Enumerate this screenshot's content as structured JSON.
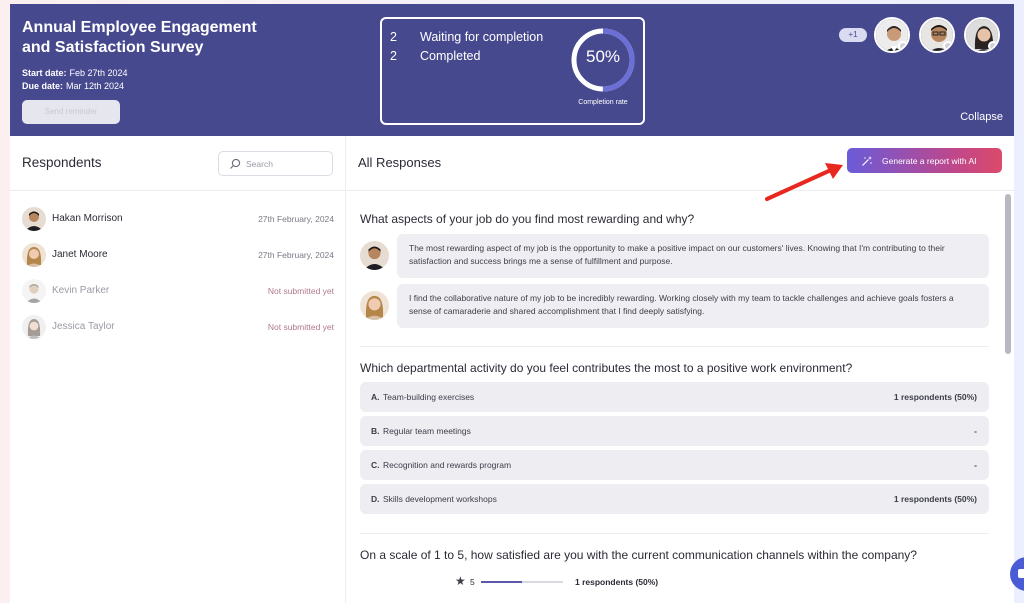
{
  "survey": {
    "title": "Annual Employee Engagement and Satisfaction Survey",
    "start_label": "Start date:",
    "start_value": "Feb 27th 2024",
    "due_label": "Due date:",
    "due_value": "Mar 12th 2024",
    "reminder_label": "Send reminder"
  },
  "stats": {
    "waiting_count": "2",
    "waiting_label": "Waiting for completion",
    "completed_count": "2",
    "completed_label": "Completed",
    "rate_text": "50%",
    "rate_fraction": 0.5,
    "rate_caption": "Completion rate"
  },
  "header": {
    "extra_badge": "+1",
    "collapse_label": "Collapse"
  },
  "respondents": {
    "title": "Respondents",
    "search_placeholder": "Search",
    "items": [
      {
        "name": "Hakan Morrison",
        "date": "27th February, 2024"
      },
      {
        "name": "Janet Moore",
        "date": "27th February, 2024"
      },
      {
        "name": "Kevin Parker",
        "date": "Not submitted yet"
      },
      {
        "name": "Jessica Taylor",
        "date": "Not submitted yet"
      }
    ]
  },
  "responses": {
    "title": "All Responses",
    "ai_button": "Generate a report with AI",
    "q1": {
      "text": "What aspects of your job do you find most rewarding and why?",
      "answers": [
        "The most rewarding aspect of my job is the opportunity to make a positive impact on our customers' lives. Knowing that I'm contributing to their satisfaction and success brings me a sense of fulfillment and purpose.",
        "I find the collaborative nature of my job to be incredibly rewarding. Working closely with my team to tackle challenges and achieve goals fosters a sense of camaraderie and shared accomplishment that I find deeply satisfying."
      ]
    },
    "q2": {
      "text": "Which departmental activity do you feel contributes the most to a positive work environment?",
      "options": [
        {
          "letter": "A.",
          "text": "Team-building exercises",
          "count": "1 respondents (50%)"
        },
        {
          "letter": "B.",
          "text": "Regular team meetings",
          "count": "-"
        },
        {
          "letter": "C.",
          "text": "Recognition and rewards program",
          "count": "-"
        },
        {
          "letter": "D.",
          "text": "Skills development workshops",
          "count": "1 respondents (50%)"
        }
      ]
    },
    "q3": {
      "text": "On a scale of 1 to 5, how satisfied are you with the current communication channels within the company?",
      "rating_value": "5",
      "rating_fraction": 0.5,
      "rating_count": "1 respondents (50%)"
    }
  },
  "colors": {
    "header_bg": "#47498f",
    "accent": "#6a5bd9",
    "ai_gradient_end": "#db4a6b",
    "arrow": "#e8281e"
  }
}
